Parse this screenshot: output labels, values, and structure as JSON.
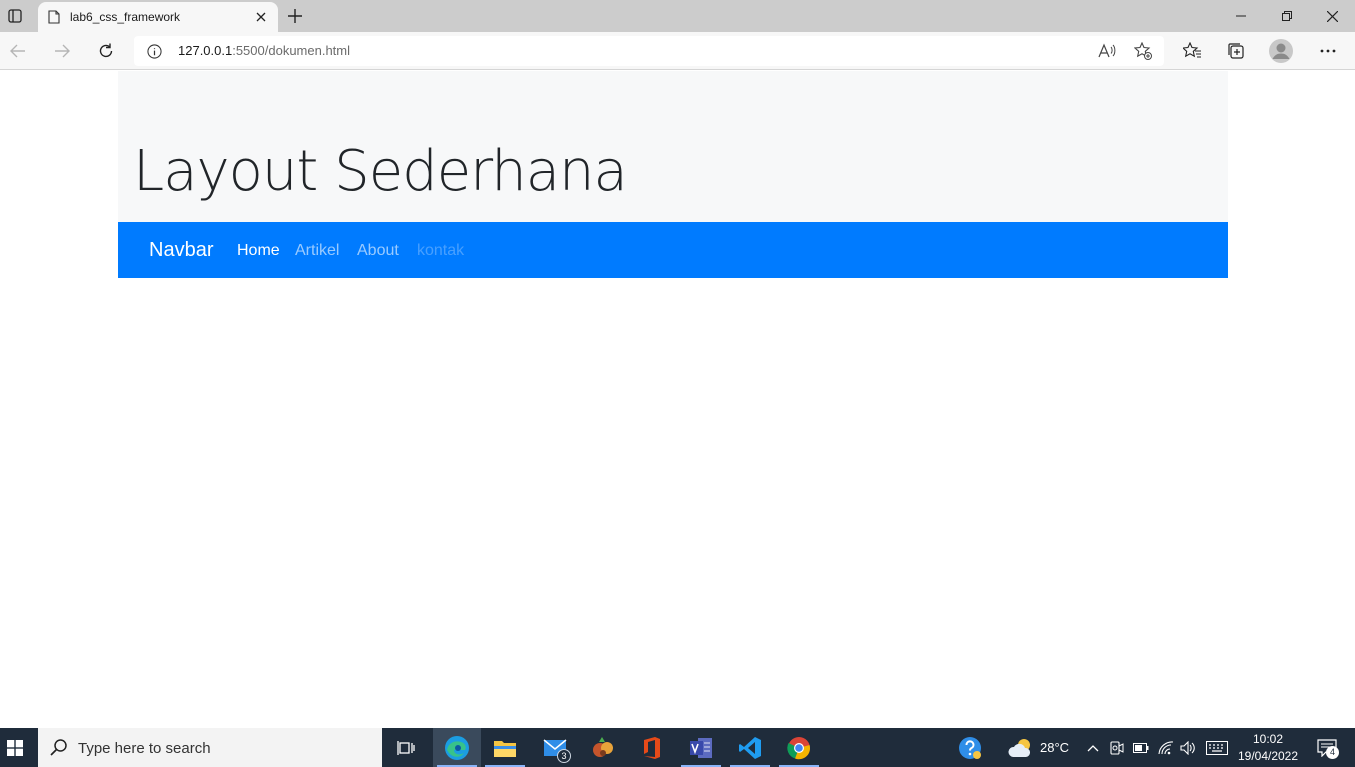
{
  "browser": {
    "tab_title": "lab6_css_framework",
    "url_host": "127.0.0.1",
    "url_path": ":5500/dokumen.html"
  },
  "page": {
    "title": "Layout Sederhana",
    "navbar": {
      "brand": "Navbar",
      "links": [
        "Home",
        "Artikel",
        "About",
        "kontak"
      ]
    },
    "colors": {
      "navbar_bg": "#007bff",
      "jumbotron_bg": "#f7f8f9"
    }
  },
  "taskbar": {
    "search_placeholder": "Type here to search",
    "mail_badge": "3",
    "weather": "28°C",
    "time": "10:02",
    "date": "19/04/2022",
    "notifications": "4",
    "apps": [
      "task-view-icon",
      "edge-icon",
      "file-explorer-icon",
      "mail-icon",
      "game-icon",
      "office-icon",
      "visual-studio-icon",
      "vscode-icon",
      "chrome-icon"
    ]
  }
}
